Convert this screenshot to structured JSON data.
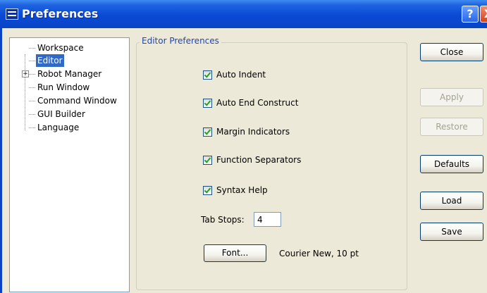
{
  "window": {
    "title": "Preferences",
    "help_button": "?",
    "close_button": "X"
  },
  "tree": {
    "items": [
      {
        "label": "Workspace",
        "selected": false,
        "expandable": false
      },
      {
        "label": "Editor",
        "selected": true,
        "expandable": false
      },
      {
        "label": "Robot Manager",
        "selected": false,
        "expandable": true,
        "expander": "+"
      },
      {
        "label": "Run Window",
        "selected": false,
        "expandable": false
      },
      {
        "label": "Command Window",
        "selected": false,
        "expandable": false
      },
      {
        "label": "GUI Builder",
        "selected": false,
        "expandable": false
      },
      {
        "label": "Language",
        "selected": false,
        "expandable": false
      }
    ]
  },
  "editor": {
    "group_title": "Editor Preferences",
    "options": [
      {
        "label": "Auto Indent",
        "checked": true
      },
      {
        "label": "Auto End Construct",
        "checked": true
      },
      {
        "label": "Margin Indicators",
        "checked": true
      },
      {
        "label": "Function Separators",
        "checked": true
      },
      {
        "label": "Syntax Help",
        "checked": true
      }
    ],
    "tab_stops": {
      "label": "Tab Stops:",
      "value": "4"
    },
    "font_button": "Font...",
    "font_value": "Courier New, 10 pt"
  },
  "buttons": {
    "close": {
      "label": "Close",
      "enabled": true
    },
    "apply": {
      "label": "Apply",
      "enabled": false
    },
    "restore": {
      "label": "Restore",
      "enabled": false
    },
    "defaults": {
      "label": "Defaults",
      "enabled": true
    },
    "load": {
      "label": "Load",
      "enabled": true
    },
    "save": {
      "label": "Save",
      "enabled": true
    }
  },
  "colors": {
    "titlebar": "#0a49d6",
    "selection": "#316ac5",
    "group_label": "#1f45b8",
    "dialog_bg": "#ece9d8"
  }
}
